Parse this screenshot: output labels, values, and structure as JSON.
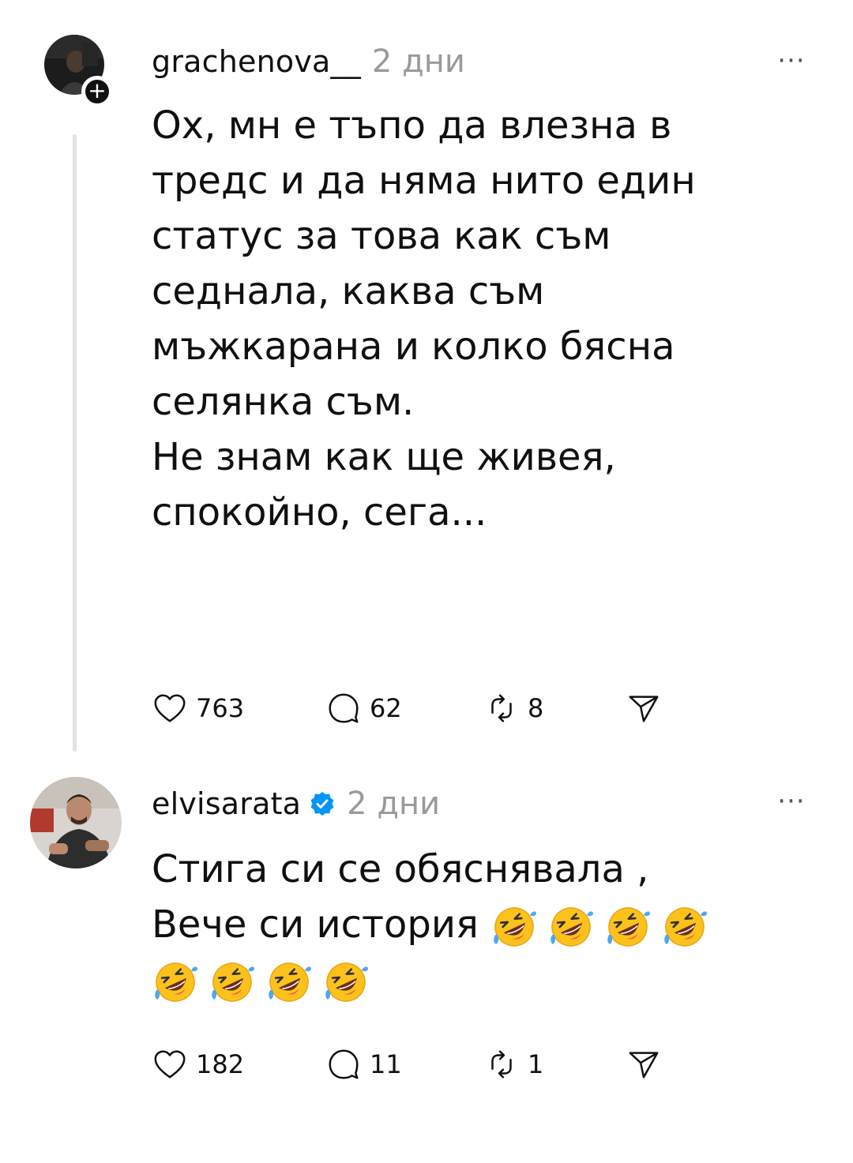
{
  "posts": [
    {
      "username": "grachenova__",
      "time": "2 дни",
      "more": "···",
      "follow_badge": "+",
      "lines": [
        "Ох, мн е тъпо да влезна в",
        "тредс и да няма нито един",
        "статус за това как съм",
        "седнала, каква съм",
        "мъжкарана и колко бясна",
        "селянка съм.",
        "Не знам как ще живея,",
        "спокойно, сега..."
      ],
      "likes": "763",
      "replies": "62",
      "reposts": "8"
    },
    {
      "username": "elvisarata",
      "time": "2 дни",
      "more": "···",
      "verified": true,
      "lines": [
        "Стига си се обяснявала ,",
        "Вече си история"
      ],
      "emoji_name": "rolling-on-the-floor-laughing-icon",
      "emoji_count_line2": 4,
      "emoji_count_line3": 4,
      "likes": "182",
      "replies": "11",
      "reposts": "1"
    }
  ],
  "colors": {
    "text": "#101010",
    "secondary": "#9a9a9a",
    "verified": "#0095f6",
    "thread_line": "#e2e2e2"
  }
}
